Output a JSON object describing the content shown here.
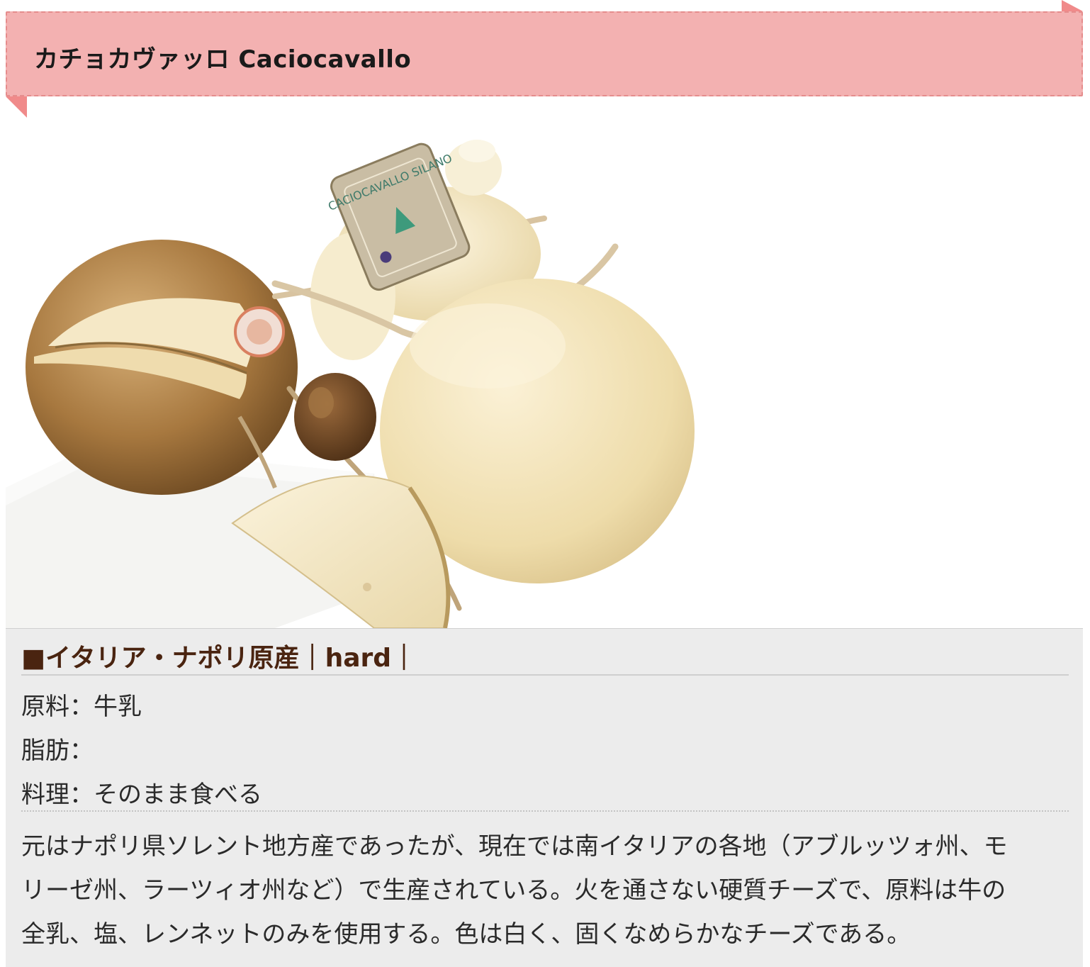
{
  "header": {
    "title": "カチョカヴァッロ Caciocavallo"
  },
  "photo": {
    "subject": "caciocavallo-cheese-photo",
    "label_text": "CACIOCAVALLO SILANO"
  },
  "info": {
    "origin_line": "■イタリア・ナポリ原産｜hard｜",
    "specs": [
      {
        "label": "原料：",
        "value": "牛乳"
      },
      {
        "label": "脂肪：",
        "value": ""
      },
      {
        "label": "料理：",
        "value": "そのまま食べる"
      }
    ],
    "description_lines": [
      "元はナポリ県ソレント地方産であったが、現在では南イタリアの各地（アブルッツォ州、モ",
      "リーゼ州、ラーツィオ州など）で生産されている。火を通さない硬質チーズで、原料は牛の",
      "全乳、塩、レンネットのみを使用する。色は白く、固くなめらかなチーズである。"
    ]
  },
  "colors": {
    "ribbon": "#f3b1b1",
    "ribbon_fold": "#f08a8a",
    "panel_bg": "#ececec",
    "origin_text": "#4a2410"
  }
}
